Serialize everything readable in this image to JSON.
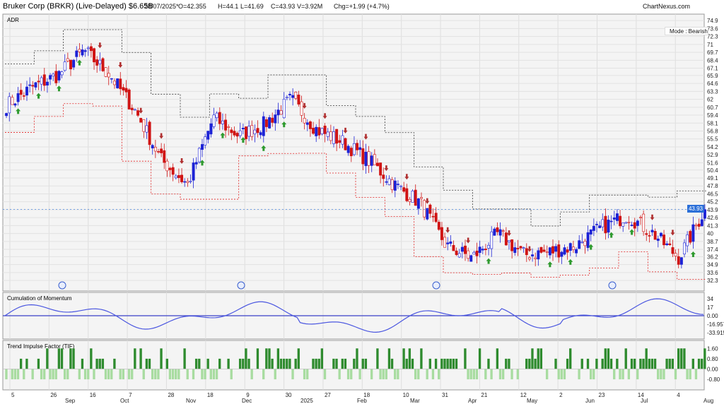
{
  "header": {
    "title": "Bruker Corp (BRKR) (Live-Delayed) $6.65B",
    "date": "28/07/2025*",
    "open": "O=42.355",
    "high": "H=44.1",
    "low": "L=41.69",
    "close": "C=43.93",
    "volume": "V=3.92M",
    "change": "Chg=+1.99 (+4.7%)",
    "brand": "ChartNexus.com"
  },
  "main_panel": {
    "label": "ADR",
    "mode_label": "Mode : Bearish",
    "last_price_label": "43.93"
  },
  "momentum_panel": {
    "label": "Cumulation of Momentum"
  },
  "tif_panel": {
    "label": "Trend Impulse Factor (TIF)"
  },
  "colors": {
    "bull": "#1c22d6",
    "bear": "#d01414",
    "arrow_up": "#2e9a2e",
    "arrow_down": "#b03030",
    "momentum_line": "#4a56e0",
    "zero_line": "#3b42c8",
    "tif_pos": "#2e8b2e",
    "tif_neg": "#a8dca0"
  },
  "chart_data": [
    {
      "type": "candlestick",
      "title": "Bruker Corp (BRKR)",
      "y_ticks": [
        "74.9",
        "73.6",
        "72.3",
        "71",
        "69.7",
        "68.4",
        "67.1",
        "65.9",
        "64.6",
        "63.3",
        "62",
        "60.7",
        "59.4",
        "58.1",
        "56.8",
        "55.5",
        "54.2",
        "52.9",
        "51.6",
        "50.4",
        "49.1",
        "47.8",
        "46.5",
        "45.2",
        "43.9",
        "42.6",
        "41.3",
        "40",
        "38.7",
        "37.4",
        "36.2",
        "34.9",
        "33.6",
        "32.3"
      ],
      "ylim": [
        31.5,
        75.5
      ],
      "x_day_ticks": [
        "5",
        "26",
        "16",
        "7",
        "28",
        "18",
        "9",
        "30",
        "27",
        "18",
        "10",
        "31",
        "21",
        "12",
        "2",
        "23",
        "14",
        "4"
      ],
      "x_month_ticks": [
        "Sep",
        "Oct",
        "Nov",
        "Dec",
        "2025",
        "Feb",
        "Mar",
        "Apr",
        "May",
        "Jun",
        "Jul",
        "Aug"
      ],
      "approx_close_path": [
        {
          "x": "Aug 2024",
          "y": 61
        },
        {
          "x": "early Sep",
          "y": 64
        },
        {
          "x": "late Sep",
          "y": 66
        },
        {
          "x": "Oct peak",
          "y": 70
        },
        {
          "x": "mid Oct",
          "y": 66
        },
        {
          "x": "Nov",
          "y": 60
        },
        {
          "x": "mid Nov",
          "y": 52
        },
        {
          "x": "Nov low",
          "y": 48
        },
        {
          "x": "Dec",
          "y": 59
        },
        {
          "x": "mid Dec",
          "y": 56
        },
        {
          "x": "late Dec",
          "y": 58
        },
        {
          "x": "Jan 2025",
          "y": 62
        },
        {
          "x": "mid Jan",
          "y": 57
        },
        {
          "x": "Feb",
          "y": 55
        },
        {
          "x": "mid Feb",
          "y": 52
        },
        {
          "x": "Mar",
          "y": 48
        },
        {
          "x": "mid Mar",
          "y": 45
        },
        {
          "x": "Apr",
          "y": 38
        },
        {
          "x": "Apr low",
          "y": 36
        },
        {
          "x": "May",
          "y": 40
        },
        {
          "x": "mid May",
          "y": 36.5
        },
        {
          "x": "Jun",
          "y": 37
        },
        {
          "x": "mid Jun",
          "y": 38
        },
        {
          "x": "late Jun",
          "y": 41
        },
        {
          "x": "Jul",
          "y": 43
        },
        {
          "x": "mid Jul",
          "y": 40
        },
        {
          "x": "late Jul",
          "y": 36
        },
        {
          "x": "28 Jul",
          "y": 43.93
        }
      ],
      "last_close": 43.93
    },
    {
      "type": "line",
      "title": "Cumulation of Momentum",
      "y_ticks": [
        "34",
        "17",
        "0.00",
        "-16.957",
        "-33.915"
      ],
      "ylim": [
        -38,
        38
      ]
    },
    {
      "type": "bar",
      "title": "Trend Impulse Factor (TIF)",
      "y_ticks": [
        "1.60",
        "0.80",
        "0.00",
        "-0.80"
      ],
      "ylim": [
        -1.4,
        2.0
      ]
    }
  ]
}
